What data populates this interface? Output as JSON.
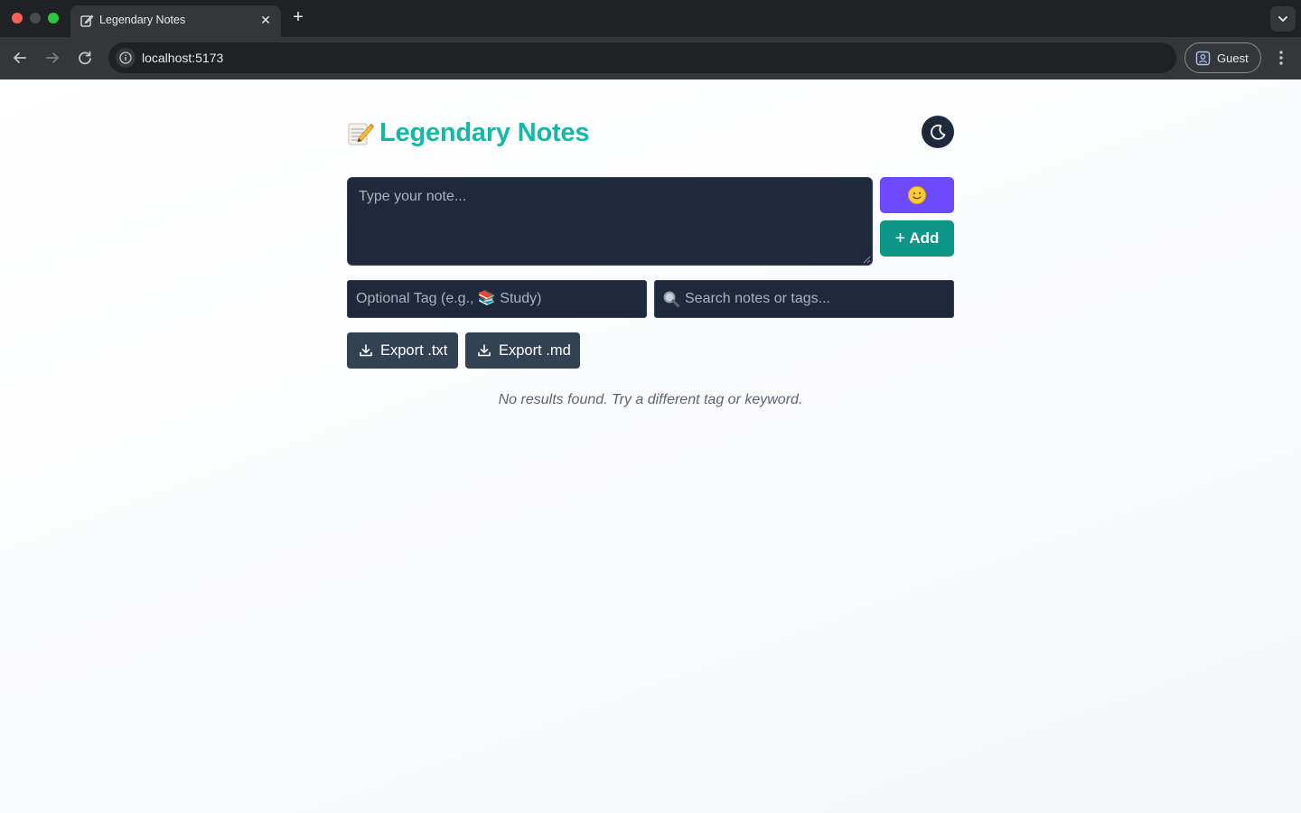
{
  "browser": {
    "tab_title": "Legendary Notes",
    "url": "localhost:5173",
    "profile_label": "Guest"
  },
  "app": {
    "title": "Legendary Notes",
    "title_icon": "memo-emoji",
    "theme_toggle_icon": "moon-icon",
    "note_placeholder": "Type your note...",
    "emoji_button_icon": "smiling-face-emoji",
    "add_button_label": "Add",
    "tag_placeholder": "Optional Tag (e.g., 📚 Study)",
    "search_placeholder": "Search notes or tags...",
    "export_txt_label": "Export .txt",
    "export_md_label": "Export .md",
    "empty_message": "No results found. Try a different tag or keyword."
  },
  "colors": {
    "title_accent": "#14b8a6",
    "emoji_button": "#6d4aff",
    "add_button": "#0f9488",
    "input_background": "#1e293b",
    "export_button": "#334155"
  }
}
